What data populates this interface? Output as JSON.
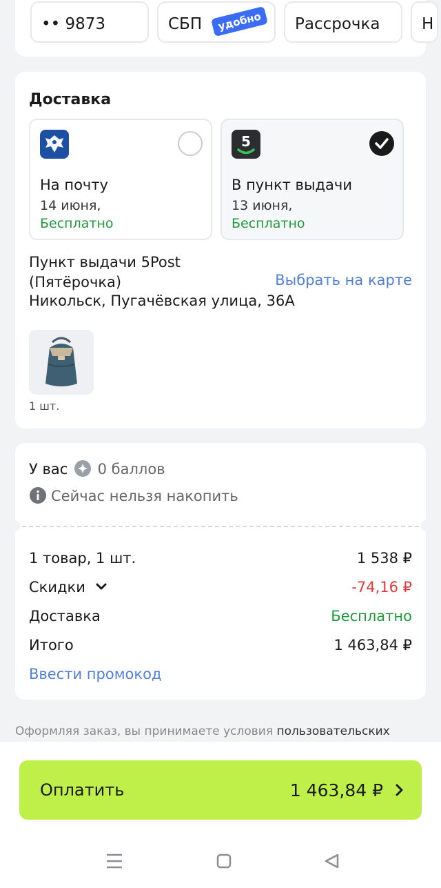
{
  "payment": {
    "chips": [
      {
        "label": "•• 9873"
      },
      {
        "label": "СБП",
        "badge": "удобно"
      },
      {
        "label": "Рассрочка"
      },
      {
        "label": "Н"
      }
    ]
  },
  "delivery": {
    "title": "Доставка",
    "options": [
      {
        "title": "На почту",
        "date": "14 июня,",
        "price": "Бесплатно",
        "selected": false,
        "icon": "russian-post-icon"
      },
      {
        "title": "В пункт выдачи",
        "date": "13 июня,",
        "price": "Бесплатно",
        "selected": true,
        "icon": "5post-icon",
        "logo_text": "5"
      }
    ],
    "pickup_name": "Пункт выдачи 5Post (Пятёрочка)",
    "map_link": "Выбрать на карте",
    "address": "Никольск, Пугачёвская улица, 36А",
    "item_qty": "1 шт."
  },
  "summary": {
    "points_prefix": "У вас",
    "points_value": "0 баллов",
    "points_note": "Сейчас нельзя накопить",
    "rows": [
      {
        "label": "1 товар, 1 шт.",
        "value": "1 538 ₽"
      },
      {
        "label": "Скидки",
        "value": "-74,16 ₽"
      },
      {
        "label": "Доставка",
        "value": "Бесплатно"
      },
      {
        "label": "Итого",
        "value": "1 463,84 ₽"
      }
    ],
    "promo_link": "Ввести промокод"
  },
  "terms": {
    "text": "Оформляя заказ, вы принимаете условия",
    "link": "пользовательских"
  },
  "pay_button": {
    "label": "Оплатить",
    "amount": "1 463,84 ₽"
  },
  "colors": {
    "accent": "#bff049",
    "link": "#4f7fd6",
    "green": "#1e9a3a",
    "red": "#e03a3a"
  }
}
